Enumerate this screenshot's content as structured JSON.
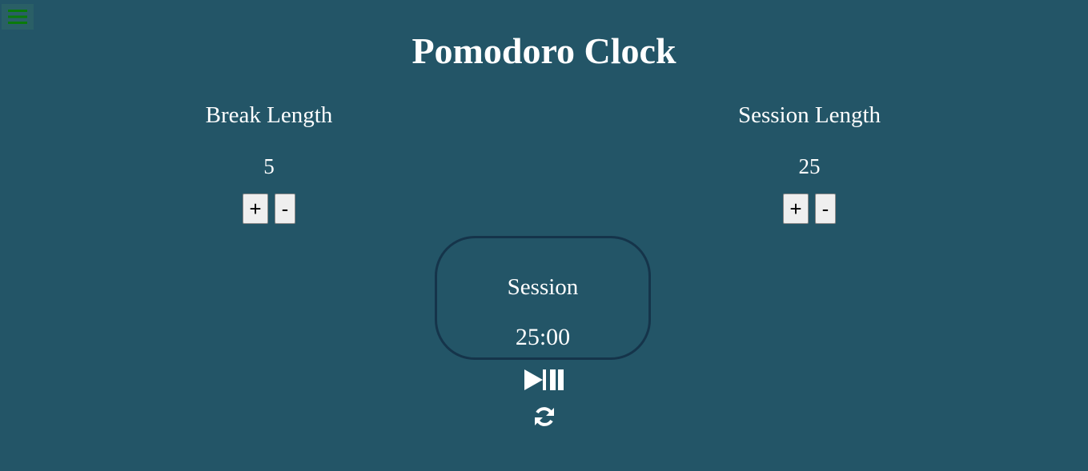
{
  "header": {
    "title": "Pomodoro Clock",
    "menu_icon": "hamburger-menu-icon",
    "menu_icon_color": "#0a7a0a"
  },
  "break": {
    "label": "Break Length",
    "value": "5",
    "increment_label": "+",
    "decrement_label": "-"
  },
  "session": {
    "label": "Session Length",
    "value": "25",
    "increment_label": "+",
    "decrement_label": "-"
  },
  "timer": {
    "label": "Session",
    "time": "25:00",
    "border_color": "#15344a"
  },
  "controls": {
    "play_pause_icon": "play-pause-icon",
    "reset_icon": "refresh-icon"
  },
  "colors": {
    "background": "#235567",
    "text": "#ffffff"
  }
}
